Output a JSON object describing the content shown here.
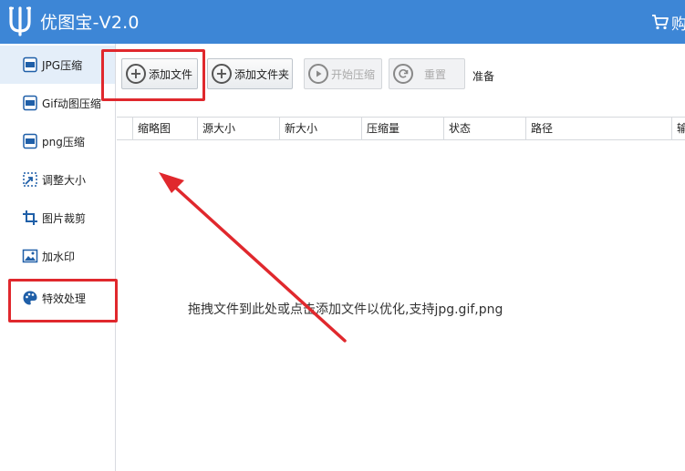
{
  "app": {
    "title": "优图宝-V2.0",
    "cart_label": "购"
  },
  "sidebar": {
    "items": [
      {
        "label": "JPG压缩",
        "icon": "jpg-file-icon"
      },
      {
        "label": "Gif动图压缩",
        "icon": "gif-file-icon"
      },
      {
        "label": "png压缩",
        "icon": "png-file-icon"
      },
      {
        "label": "调整大小",
        "icon": "resize-icon"
      },
      {
        "label": "图片裁剪",
        "icon": "crop-icon"
      },
      {
        "label": "加水印",
        "icon": "watermark-icon"
      },
      {
        "label": "特效处理",
        "icon": "palette-icon"
      }
    ],
    "active_index": 0
  },
  "toolbar": {
    "add_file": "添加文件",
    "add_folder": "添加文件夹",
    "start": "开始压缩",
    "reset": "重置",
    "status": "准备"
  },
  "table": {
    "columns": [
      "",
      "缩略图",
      "源大小",
      "新大小",
      "压缩量",
      "状态",
      "路径",
      "输"
    ]
  },
  "content": {
    "hint": "拖拽文件到此处或点击添加文件以优化,支持jpg.gif,png"
  },
  "colors": {
    "titlebar": "#3d86d6",
    "annotation_red": "#e0282d",
    "sidebar_active": "#e4eef9"
  }
}
